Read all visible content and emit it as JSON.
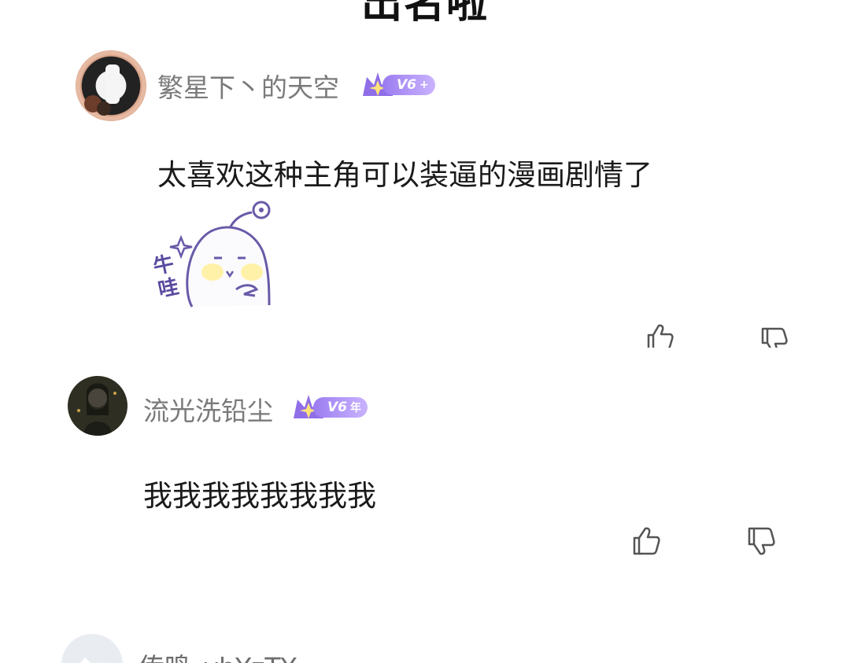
{
  "header": {
    "title": "出名啦"
  },
  "comments": [
    {
      "username": "繁星下丶的天空",
      "badge": {
        "level": "V6",
        "suffix": "+"
      },
      "text": "太喜欢这种主角可以装逼的漫画剧情了",
      "sticker": {
        "caption": "牛哇"
      }
    },
    {
      "username": "流光洗铅尘",
      "badge": {
        "level": "V6",
        "suffix": "年"
      },
      "text": "我我我我我我我我"
    },
    {
      "username": "传鸣_yhYzTY"
    }
  ],
  "icons": {
    "like": "thumbs-up-icon",
    "dislike": "thumbs-down-icon",
    "badge": "crown-star-icon"
  },
  "colors": {
    "username": "#7a7a7a",
    "text": "#1a1a1a",
    "badge": "#9b7cf0",
    "icon": "#444444"
  }
}
